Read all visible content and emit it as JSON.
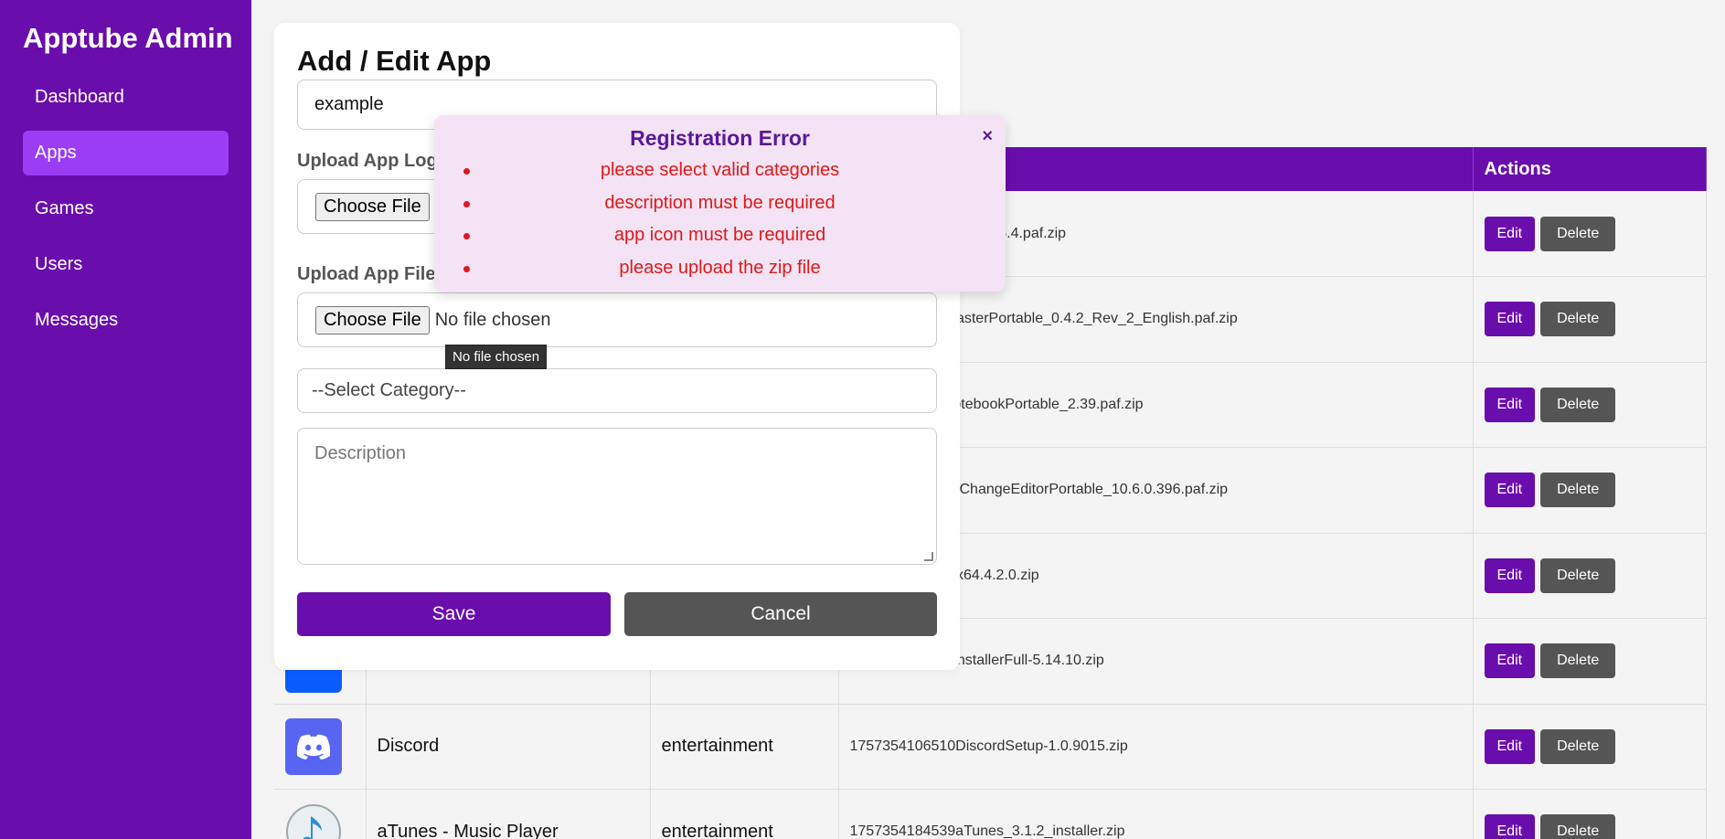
{
  "sidebar": {
    "brand": "Apptube Admin",
    "items": [
      {
        "label": "Dashboard"
      },
      {
        "label": "Apps"
      },
      {
        "label": "Games"
      },
      {
        "label": "Users"
      },
      {
        "label": "Messages"
      }
    ]
  },
  "table": {
    "headers": [
      "",
      "",
      "",
      "",
      "Actions"
    ],
    "rows": [
      {
        "name": "",
        "category": "",
        "file": "aPortable_1.6.4.paf.zip"
      },
      {
        "name": "",
        "category": "",
        "file": "TypeFasterPortable_0.4.2_Rev_2_English.paf.zip"
      },
      {
        "name": "",
        "category": "",
        "file": "RedNotebookPortable_2.39.paf.zip"
      },
      {
        "name": "",
        "category": "",
        "file": "PDF-XChangeEditorPortable_10.6.0.396.paf.zip"
      },
      {
        "name": "",
        "category": "",
        "file": "setup-x64.4.2.0.zip"
      },
      {
        "name": "",
        "category": "",
        "file": "ZoomInstallerFull-5.14.10.zip"
      },
      {
        "name": "Discord",
        "category": "entertainment",
        "file": "1757354106510DiscordSetup-1.0.9015.zip"
      },
      {
        "name": "aTunes - Music Player",
        "category": "entertainment",
        "file": "1757354184539aTunes_3.1.2_installer.zip"
      }
    ],
    "edit_label": "Edit",
    "delete_label": "Delete"
  },
  "modal": {
    "title": "Add / Edit App",
    "name_value": "example",
    "logo_label": "Upload App Log",
    "file_label": "Upload App File",
    "choose_file": "Choose File",
    "no_file": "No file chosen",
    "category_placeholder": "--Select Category--",
    "description_placeholder": "Description",
    "save": "Save",
    "cancel": "Cancel"
  },
  "tooltip": "No file chosen",
  "error": {
    "title": "Registration Error",
    "close": "×",
    "messages": [
      "please select valid categories",
      "description must be required",
      "app icon must be required",
      "please upload the zip file"
    ]
  },
  "colors": {
    "primary": "#6a0dad",
    "sidebar_active": "#9a3df5",
    "error": "#e01818"
  }
}
